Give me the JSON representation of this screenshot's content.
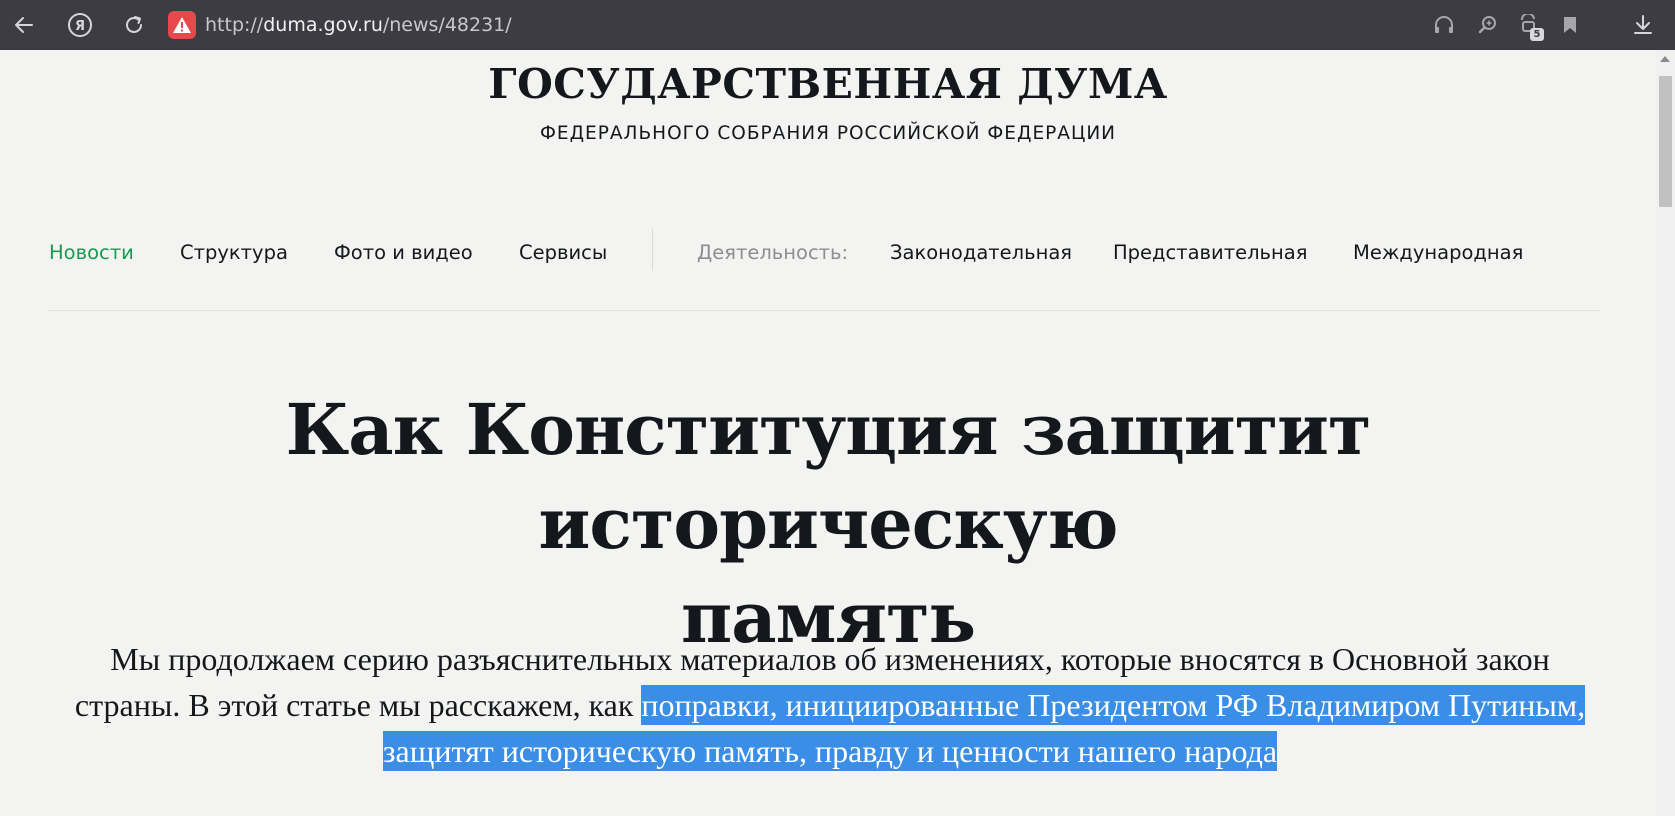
{
  "browser": {
    "url_scheme": "http://",
    "url_host": "duma.gov.ru",
    "url_path": "/news/48231/",
    "tab_count": "5",
    "colors": {
      "toolbar": "#3c3c42",
      "warning": "#e7484c"
    }
  },
  "site": {
    "title": "ГОСУДАРСТВЕННАЯ ДУМА",
    "subtitle": "ФЕДЕРАЛЬНОГО СОБРАНИЯ РОССИЙСКОЙ ФЕДЕРАЦИИ"
  },
  "nav": {
    "items": [
      {
        "label": "Новости",
        "active": true
      },
      {
        "label": "Структура"
      },
      {
        "label": "Фото и видео"
      },
      {
        "label": "Сервисы"
      }
    ],
    "activity_label": "Деятельность:",
    "activity_items": [
      {
        "label": "Законодательная"
      },
      {
        "label": "Представительная"
      },
      {
        "label": "Международная"
      }
    ],
    "active_color": "#1a9a50"
  },
  "article": {
    "headline_line1": "Как Конституция защитит историческую",
    "headline_line2": "память",
    "lead_plain": "Мы продолжаем серию разъяснительных материалов об изменениях, которые вносятся в Основной закон страны. В этой статье мы расскажем, как ",
    "lead_selected": "поправки, инициированные Президентом РФ Владимиром Путиным, защитят историческую память, правду и ценности нашего народа",
    "selection_color": "#3a8ee6"
  }
}
